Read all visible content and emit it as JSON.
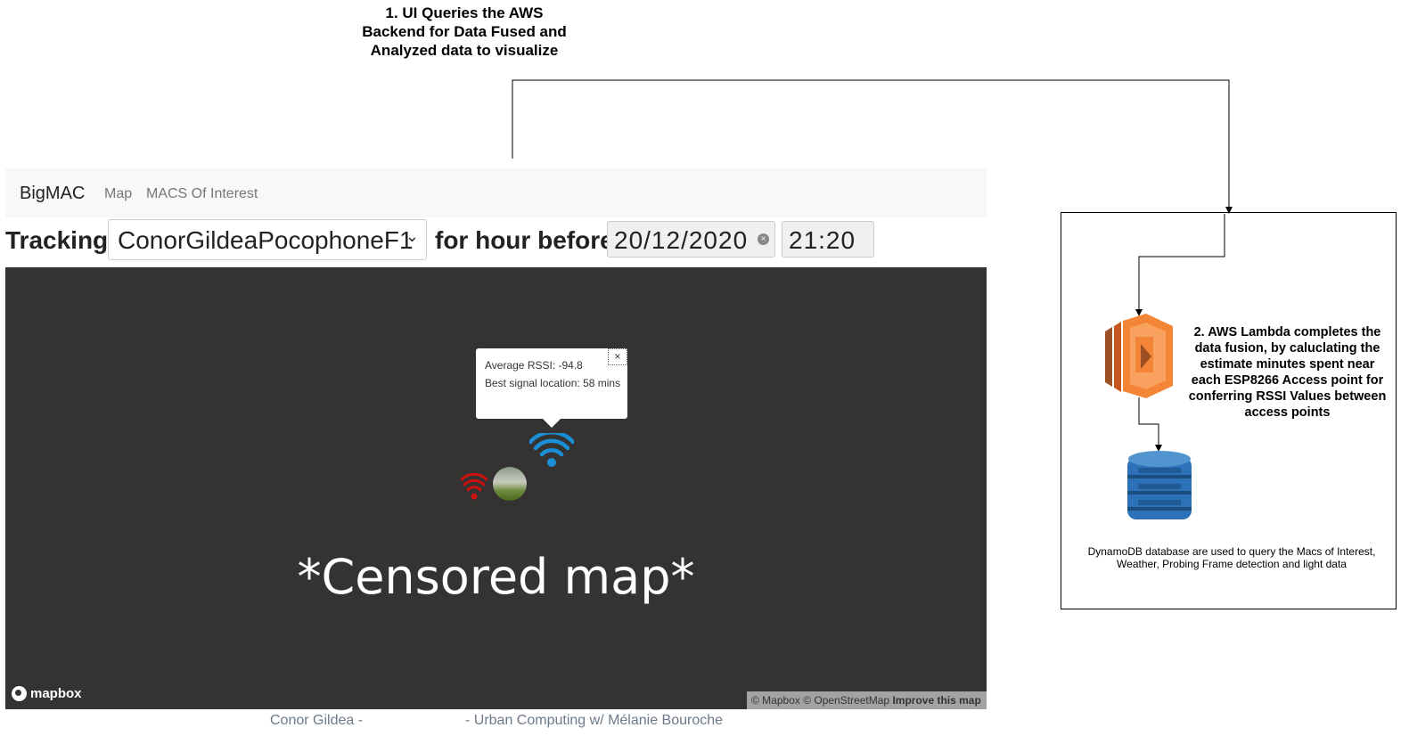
{
  "annotations": {
    "step1": "1. UI Queries the AWS Backend for Data Fused and Analyzed data to visualize",
    "step2": "2. AWS Lambda completes the data fusion, by caluclating the estimate minutes spent near each ESP8266 Access point for conferring RSSI Values between access points",
    "dynamo_caption": "DynamoDB database are used to query the Macs of Interest, Weather, Probing Frame detection and light data"
  },
  "navbar": {
    "brand": "BigMAC",
    "links": [
      "Map",
      "MACS Of Interest"
    ]
  },
  "tracking": {
    "label": "Tracking",
    "device_value": "ConorGildeaPocophoneF1",
    "hour_label": "for hour before",
    "date_value": "20/12/2020",
    "time_value": "21:20"
  },
  "map": {
    "overlay_text": "*Censored map*",
    "popup": {
      "close": "×",
      "average_rssi": "Average RSSI: -94.8",
      "best_signal": "Best signal location: 58 mins"
    },
    "logo_text": "mapbox",
    "attribution": "© Mapbox © OpenStreetMap",
    "improve": "Improve this map"
  },
  "footer": {
    "left": "Conor Gildea -",
    "right": "- Urban Computing w/ Mélanie Bouroche"
  },
  "colors": {
    "map_bg": "#343332",
    "wifi_active": "#1a8fd6",
    "wifi_weak": "#cc1111",
    "lambda_orange": "#f58536",
    "dynamo_blue": "#2d72b8"
  },
  "icons": [
    "wifi-icon",
    "avatar",
    "lambda-icon",
    "dynamodb-icon",
    "mapbox-logo-icon",
    "chevron-down-icon",
    "clear-icon",
    "close-icon"
  ]
}
